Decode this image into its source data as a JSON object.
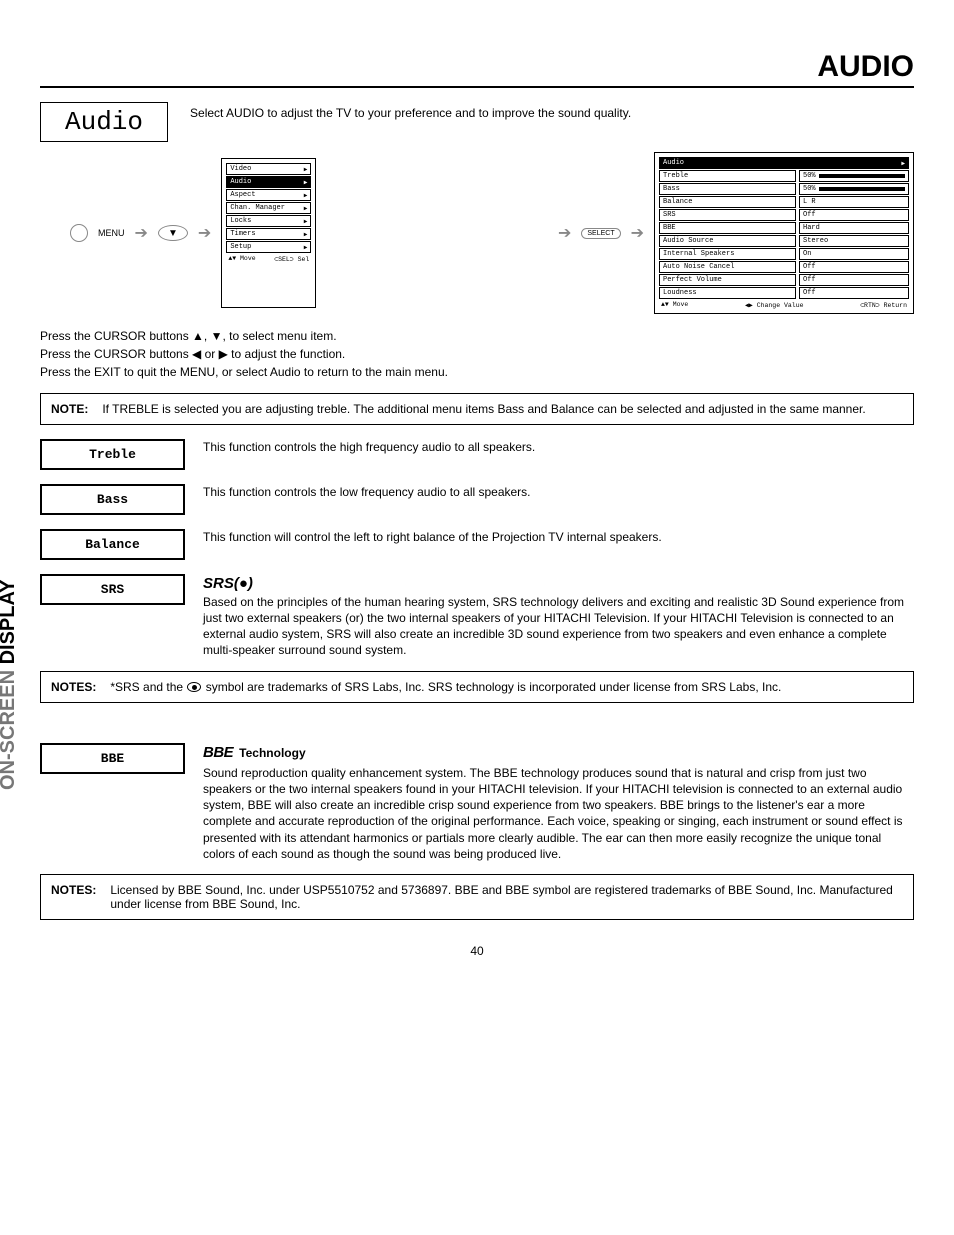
{
  "header": {
    "title": "AUDIO"
  },
  "audio_box": {
    "label": "Audio"
  },
  "intro": "Select AUDIO to adjust the TV to your preference and to improve the sound quality.",
  "flow": {
    "menu_label": "MENU",
    "select_label": "SELECT"
  },
  "osd_small": {
    "items": [
      "Video",
      "Audio",
      "Aspect",
      "Chan. Manager",
      "Locks",
      "Timers",
      "Setup"
    ],
    "highlight_index": 1,
    "footer_move": "Move",
    "footer_sel": "Sel"
  },
  "osd_large": {
    "header": "Audio",
    "rows": [
      {
        "label": "Treble",
        "value": "50%",
        "bar": 50
      },
      {
        "label": "Bass",
        "value": "50%",
        "bar": 50
      },
      {
        "label": "Balance",
        "value": "L          R",
        "balance": true
      },
      {
        "label": "SRS",
        "value": "Off"
      },
      {
        "label": "BBE",
        "value": "Hard"
      },
      {
        "label": "Audio Source",
        "value": "Stereo"
      },
      {
        "label": "Internal Speakers",
        "value": "On"
      },
      {
        "label": "Auto Noise Cancel",
        "value": "Off"
      },
      {
        "label": "Perfect Volume",
        "value": "Off"
      },
      {
        "label": "Loudness",
        "value": "Off"
      }
    ],
    "footer_move": "Move",
    "footer_change": "Change Value",
    "footer_return": "Return"
  },
  "instructions": [
    "Press the CURSOR buttons ▲, ▼, to select menu item.",
    "Press the CURSOR buttons  ◀ or ▶ to adjust the function.",
    "Press the EXIT to quit the MENU, or select Audio to return to the main menu."
  ],
  "note1": {
    "label": "NOTE:",
    "text": "If TREBLE is selected you are adjusting treble.  The additional menu items Bass and Balance can be selected and adjusted in the same manner."
  },
  "features": {
    "treble": {
      "label": "Treble",
      "text": "This function controls the high frequency audio to all speakers."
    },
    "bass": {
      "label": "Bass",
      "text": "This function controls the low frequency audio to all speakers."
    },
    "balance": {
      "label": "Balance",
      "text": "This function will control the left to right balance of the Projection TV internal speakers."
    },
    "srs": {
      "label": "SRS",
      "logo": "SRS(●)",
      "text": "Based on the principles of the human hearing system, SRS technology delivers and exciting and realistic 3D Sound experience from just two external speakers (or) the two internal speakers of your HITACHI Television.  If your HITACHI Television is connected to an external audio system, SRS will also create an incredible 3D sound experience from two speakers and even enhance a complete multi-speaker surround sound system."
    },
    "bbe": {
      "label": "BBE",
      "logo": "BBE",
      "tech_word": "Technology",
      "text": "Sound reproduction quality enhancement system.  The BBE technology produces sound that is natural and crisp from just two speakers or the two internal speakers found in your HITACHI television. If your HITACHI television is connected to an external audio system, BBE will also create an incredible crisp sound experience from two speakers.  BBE brings to the listener's ear a more complete and accurate reproduction of the original performance.  Each voice, speaking or singing, each instrument or sound effect is presented with its attendant harmonics or partials more clearly audible.  The ear can then more easily recognize the unique tonal colors of each sound as though the sound was being produced live."
    }
  },
  "notes_srs": {
    "label": "NOTES:",
    "text_a": "*SRS and the ",
    "text_b": " symbol are trademarks of SRS Labs, Inc. SRS technology is incorporated under license from SRS Labs, Inc."
  },
  "notes_bbe": {
    "label": "NOTES:",
    "text": "Licensed by BBE Sound, Inc. under USP5510752 and 5736897.  BBE and BBE symbol are registered trademarks of BBE Sound, Inc.  Manufactured under license from BBE Sound, Inc."
  },
  "side_tab": {
    "shaded": "ON-SCREEN",
    "solid": " DISPLAY"
  },
  "page_number": "40"
}
